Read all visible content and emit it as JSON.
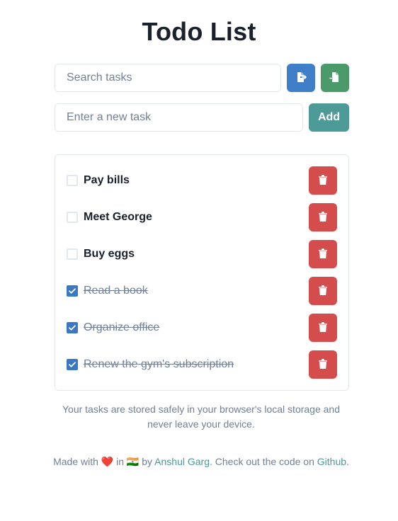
{
  "app": {
    "title": "Todo List"
  },
  "search": {
    "placeholder": "Search tasks"
  },
  "toolbar": {
    "export_icon": "file-export-icon",
    "import_icon": "file-import-icon"
  },
  "new_task": {
    "placeholder": "Enter a new task",
    "add_label": "Add"
  },
  "tasks": [
    {
      "label": "Pay bills",
      "done": false
    },
    {
      "label": "Meet George",
      "done": false
    },
    {
      "label": "Buy eggs",
      "done": false
    },
    {
      "label": "Read a book",
      "done": true
    },
    {
      "label": "Organize office",
      "done": true
    },
    {
      "label": "Renew the gym's subscription",
      "done": true
    }
  ],
  "footer": {
    "storage_note": "Your tasks are stored safely in your browser's local storage and never leave your device.",
    "made_with": "Made with",
    "heart": "❤️",
    "in": "in",
    "flag": "🇮🇳",
    "by": "by",
    "author": "Anshul Garg",
    "check_code": ". Check out the code on",
    "github": "Github",
    "period": "."
  },
  "colors": {
    "export": "#3f7fca",
    "import": "#4a9a6a",
    "add": "#4e9a98",
    "delete": "#d44c4c",
    "checkbox": "#3b78c4",
    "link": "#4a9a98"
  }
}
